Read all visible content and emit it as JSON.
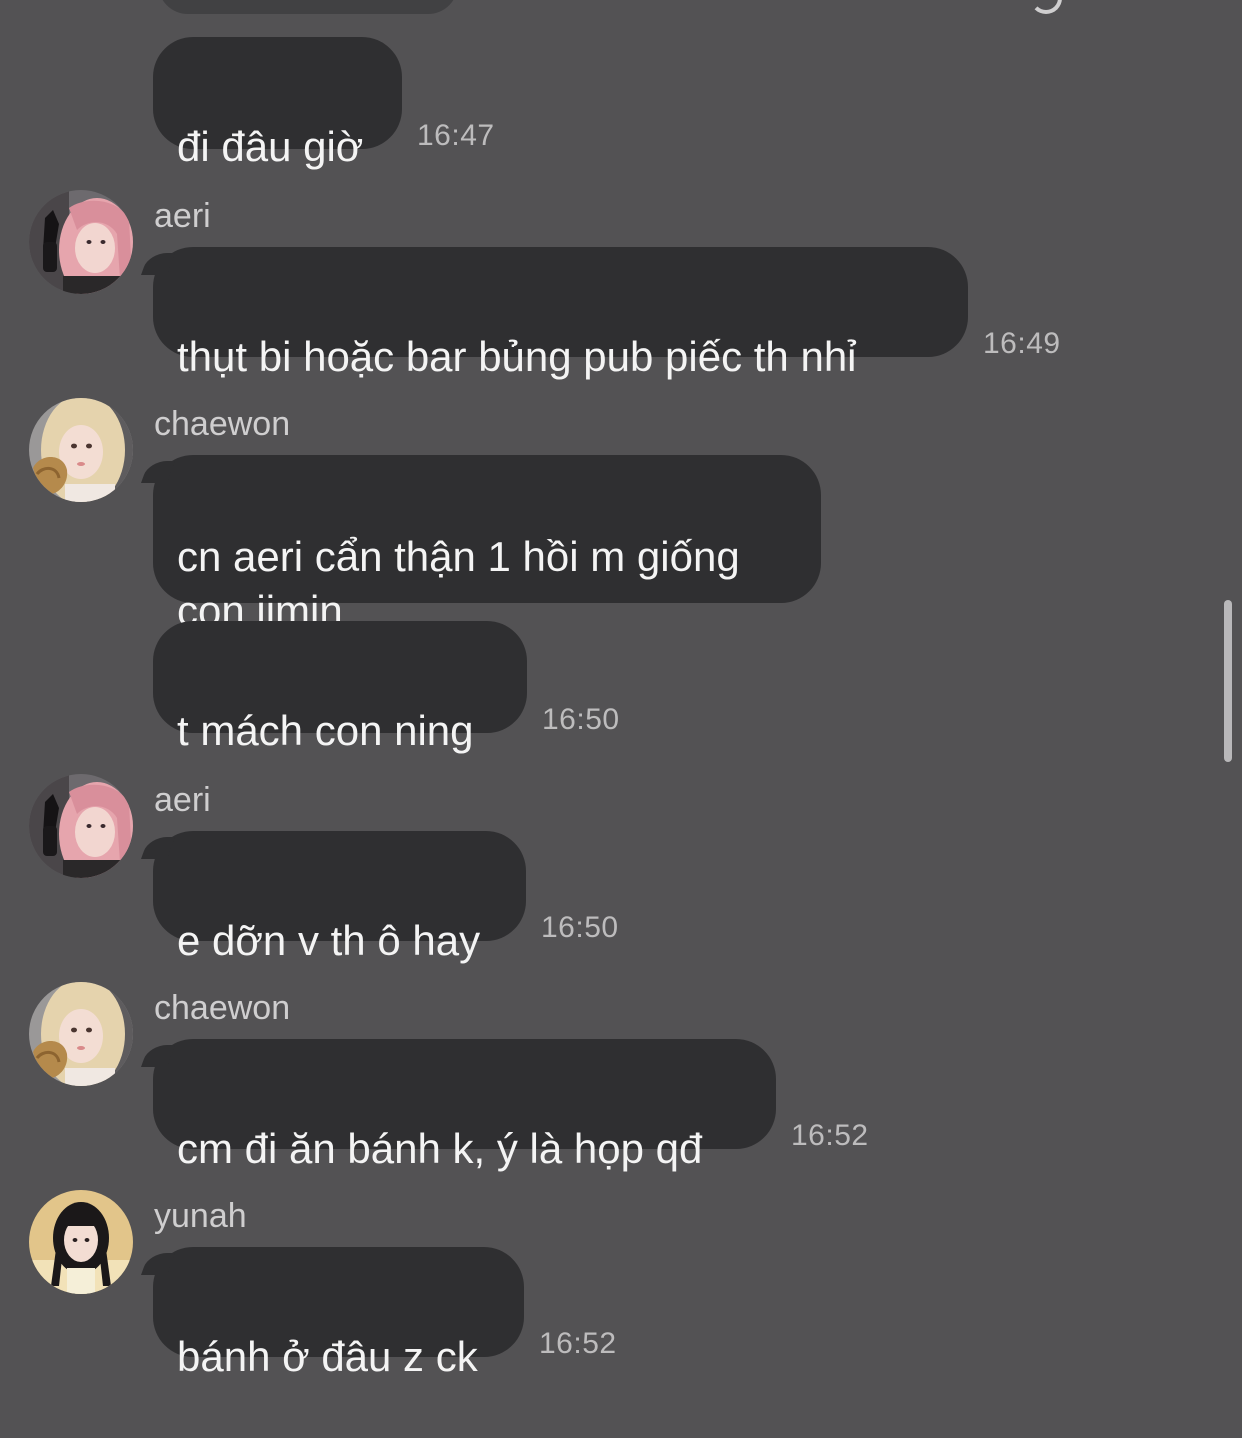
{
  "messages": [
    {
      "sender": "",
      "text": "đi đâu giờ",
      "time": "16:47"
    },
    {
      "sender": "aeri",
      "text": "thụt bi hoặc bar bủng pub piếc th nhỉ",
      "time": "16:49"
    },
    {
      "sender": "chaewon",
      "text": "cn aeri cẩn thận 1 hồi m giống\ncon jimin",
      "time": ""
    },
    {
      "sender": "",
      "text": "t mách con ning",
      "time": "16:50"
    },
    {
      "sender": "aeri",
      "text": "e dỡn v th ô hay",
      "time": "16:50"
    },
    {
      "sender": "chaewon",
      "text": "cm đi ăn bánh k, ý là họp qđ",
      "time": "16:52"
    },
    {
      "sender": "yunah",
      "text": "bánh ở đâu z ck",
      "time": "16:52"
    }
  ],
  "avatars": {
    "aeri": "pink-hair-avatar",
    "chaewon": "blonde-hair-avatar",
    "yunah": "black-hair-avatar"
  },
  "colors": {
    "background": "#535254",
    "bubble": "#2f2f31",
    "text": "#f4f4f4",
    "time": "#bdbcbd"
  }
}
